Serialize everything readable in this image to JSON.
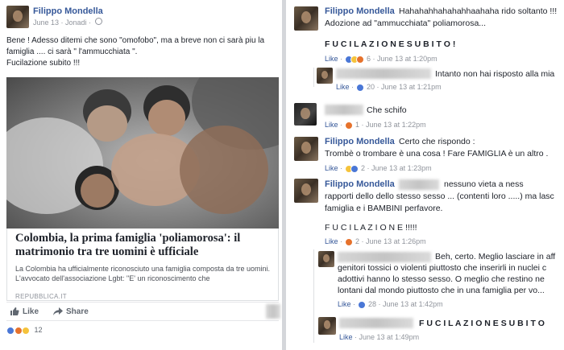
{
  "left_post": {
    "author": "Filippo Mondella",
    "timestamp": "June 13 · Jonadi ·",
    "body_lines": [
      "Bene ! Adesso ditemi che sono \"omofobo\", ma a breve non ci sarà piu la",
      "famiglia .... ci sarà \" l'ammucchiata \".",
      "Fucilazione subito !!!"
    ],
    "link": {
      "title": "Colombia, la prima famiglia 'poliamorosa': il matrimonio tra tre uomini è ufficiale",
      "description_lines": [
        "La Colombia ha ufficialmente riconosciuto una famiglia composta da tre uomini.",
        "L'avvocato dell'associazione Lgbt: \"E' un riconoscimento che"
      ],
      "source": "REPUBBLICA.IT"
    },
    "actions": {
      "like": "Like",
      "share": "Share"
    },
    "reaction_count": "12"
  },
  "comments": [
    {
      "author": "Filippo Mondella",
      "lines": [
        "Hahahahhahahahhaahaha rido soltanto !!!",
        "Adozione ad \"ammucchiata\" poliamorosa...",
        "",
        "F U C I L A Z I O N E  S U B I T O !"
      ],
      "like": "Like",
      "count": "6",
      "time": "June 13 at 1:20pm"
    },
    {
      "author": "",
      "lines": [
        "Intanto non hai risposto alla mia"
      ],
      "like": "Like",
      "count": "20",
      "time": "June 13 at 1:21pm"
    },
    {
      "author": "",
      "lines": [
        "Che schifo"
      ],
      "like": "Like",
      "count": "1",
      "time": "June 13 at 1:22pm"
    },
    {
      "author": "Filippo Mondella",
      "lines": [
        "Certo che rispondo :",
        "Trombè o trombare è una cosa ! Fare FAMIGLIA è un altro ."
      ],
      "like": "Like",
      "count": "2",
      "time": "June 13 at 1:23pm"
    },
    {
      "author": "Filippo Mondella",
      "lines": [
        "nessuno vieta a ness",
        "rapporti dello dello stesso sesso ... (contenti loro .....) ma lasc",
        "famiglia e i BAMBINI perfavore.",
        "",
        "F U C I L A Z I O N E !!!!!"
      ],
      "like": "Like",
      "count": "2",
      "time": "June 13 at 1:26pm"
    },
    {
      "author": "",
      "lines": [
        "Beh, certo. Meglio lasciare in aff",
        "genitori tossici o violenti piuttosto che inserirli in nuclei c",
        "adottivi hanno lo stesso sesso. O meglio che restino ne",
        "lontani dal mondo piuttosto che in una famiglia per vo..."
      ],
      "like": "Like",
      "count": "28",
      "time": "June 13 at 1:42pm"
    },
    {
      "author": "",
      "lines": [
        "F U C I L A Z I O N E  S U B I T O"
      ],
      "like": "Like",
      "count": "",
      "time": "June 13 at 1:49pm"
    }
  ],
  "colors": {
    "link": "#365899",
    "meta": "#90949c",
    "text": "#1d2129"
  }
}
